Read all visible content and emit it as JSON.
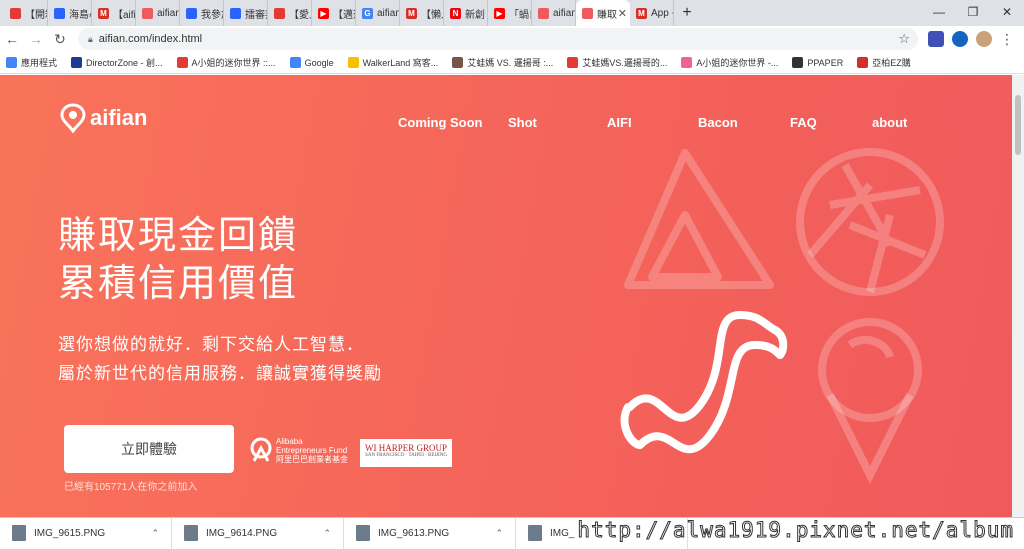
{
  "browser": {
    "tabs": [
      {
        "label": "【開箱",
        "color": "#e53935",
        "glyph": ""
      },
      {
        "label": "海島心",
        "color": "#2962ff",
        "glyph": ""
      },
      {
        "label": "【aifia",
        "color": "#d93025",
        "glyph": "M"
      },
      {
        "label": "aifian",
        "color": "#f05a5c",
        "glyph": ""
      },
      {
        "label": "我參加",
        "color": "#2962ff",
        "glyph": ""
      },
      {
        "label": "擂審邦",
        "color": "#2962ff",
        "glyph": ""
      },
      {
        "label": "【愛上",
        "color": "#e53935",
        "glyph": ""
      },
      {
        "label": "【邁逝",
        "color": "#ff0000",
        "glyph": "▶"
      },
      {
        "label": "aifian",
        "color": "#4285f4",
        "glyph": "G"
      },
      {
        "label": "【懶人",
        "color": "#d93025",
        "glyph": "M"
      },
      {
        "label": "新創 A",
        "color": "#e50914",
        "glyph": "N"
      },
      {
        "label": "「蝸日",
        "color": "#ff0000",
        "glyph": "▶"
      },
      {
        "label": "aifian",
        "color": "#f05a5c",
        "glyph": ""
      },
      {
        "label": "賺取",
        "color": "#f05a5c",
        "glyph": ""
      },
      {
        "label": "App -",
        "color": "#d93025",
        "glyph": "M"
      }
    ],
    "new_tab": "+",
    "window_controls": [
      "—",
      "❐",
      "✕"
    ],
    "url": "aifian.com/index.html",
    "bookmarks": [
      {
        "label": "應用程式",
        "color": "#4285f4"
      },
      {
        "label": "DirectorZone - 創...",
        "color": "#1f3a93"
      },
      {
        "label": "A小姐的迷你世界 ::...",
        "color": "#e53935"
      },
      {
        "label": "Google",
        "color": "#4285f4"
      },
      {
        "label": "WalkerLand 窩客...",
        "color": "#f5c000"
      },
      {
        "label": "艾蛙媽 VS. 邏揚哥 :...",
        "color": "#795548"
      },
      {
        "label": "艾蛙媽VS.邏揚哥的...",
        "color": "#e53935"
      },
      {
        "label": "A小姐的迷你世界 -...",
        "color": "#f06292"
      },
      {
        "label": "PPAPER",
        "color": "#333333"
      },
      {
        "label": "亞柏EZ購",
        "color": "#d32f2f"
      }
    ]
  },
  "site": {
    "logo_text": "aifian",
    "nav": [
      "Coming Soon",
      "Shot",
      "AIFI",
      "Bacon",
      "FAQ",
      "about"
    ],
    "headline_line1": "賺取現金回饋",
    "headline_line2": "累積信用價值",
    "sub_line1": "選你想做的就好．剩下交給人工智慧．",
    "sub_line2": "屬於新世代的信用服務．讓誠實獲得獎勵",
    "cta_label": "立即體驗",
    "count_text": "已經有105771人在你之前加入",
    "partner1_line1": "Alibaba",
    "partner1_line2": "Entrepreneurs Fund",
    "partner1_line3": "阿里巴巴創業者基金",
    "partner2_line1": "WI HARPER GROUP",
    "partner2_line2": "SAN FRANCISCO · TAIPEI · BEIJING",
    "accent": "#f4625a"
  },
  "downloads": [
    {
      "name": "IMG_9615.PNG"
    },
    {
      "name": "IMG_9614.PNG"
    },
    {
      "name": "IMG_9613.PNG"
    },
    {
      "name": "IMG_"
    }
  ],
  "watermark": "http://alwa1919.pixnet.net/album"
}
